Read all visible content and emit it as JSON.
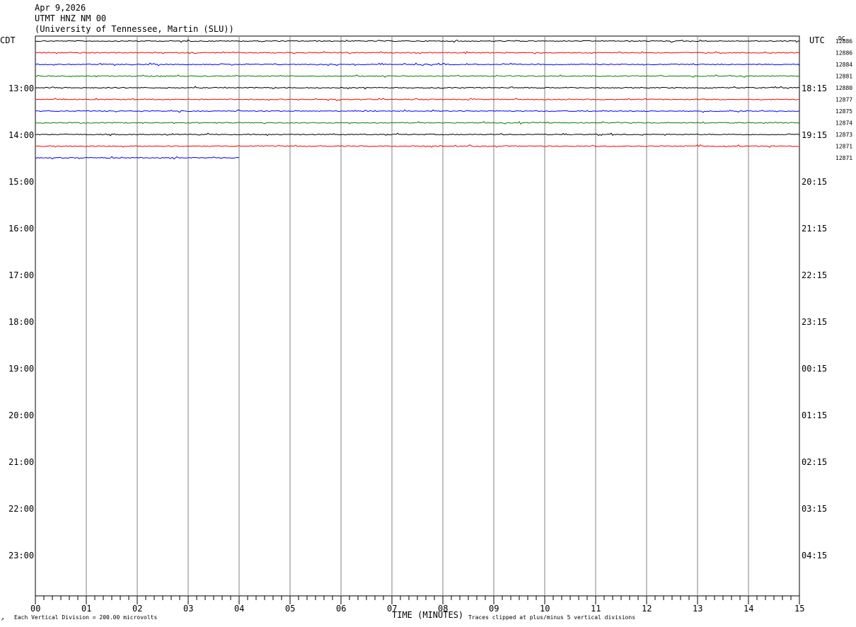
{
  "header": {
    "date": "Apr 9,2026",
    "station": "UTMT HNZ NM 00",
    "institution": "(University of Tennessee, Martin (SLU))"
  },
  "chart_data": {
    "type": "line",
    "title": "UTMT HNZ NM 00",
    "xlabel": "TIME (MINUTES)",
    "left_axis_label": "CDT",
    "right_axis_label": "UTC",
    "dc_label": "DC",
    "x_range": [
      0,
      15
    ],
    "x_ticks": [
      "00",
      "01",
      "02",
      "03",
      "04",
      "05",
      "06",
      "07",
      "08",
      "09",
      "10",
      "11",
      "12",
      "13",
      "14",
      "15"
    ],
    "cdt_hour_labels": [
      "13:00",
      "14:00",
      "15:00",
      "16:00",
      "17:00",
      "18:00",
      "19:00",
      "20:00",
      "21:00",
      "22:00",
      "23:00"
    ],
    "utc_hour_labels": [
      "18:15",
      "19:15",
      "20:15",
      "21:15",
      "22:15",
      "23:15",
      "00:15",
      "01:15",
      "02:15",
      "03:15",
      "04:15"
    ],
    "trace_colors": [
      "#000000",
      "#ff0000",
      "#0000ff",
      "#008000"
    ],
    "traces": [
      {
        "start_min": 0,
        "end_min": 15,
        "dc": "12886"
      },
      {
        "start_min": 0,
        "end_min": 15,
        "dc": "12886"
      },
      {
        "start_min": 0,
        "end_min": 15,
        "dc": "12884"
      },
      {
        "start_min": 0,
        "end_min": 15,
        "dc": "12881"
      },
      {
        "start_min": 0,
        "end_min": 15,
        "dc": "12880"
      },
      {
        "start_min": 0,
        "end_min": 15,
        "dc": "12877"
      },
      {
        "start_min": 0,
        "end_min": 15,
        "dc": "12875"
      },
      {
        "start_min": 0,
        "end_min": 15,
        "dc": "12874"
      },
      {
        "start_min": 0,
        "end_min": 15,
        "dc": "12873"
      },
      {
        "start_min": 0,
        "end_min": 15,
        "dc": "12871"
      },
      {
        "start_min": 0,
        "end_min": 4,
        "dc": "12871"
      }
    ],
    "footer_scale": "Each Vertical Division =  200.00 microvolts",
    "footer_clip": "Traces clipped at plus/minus 5 vertical divisions"
  }
}
